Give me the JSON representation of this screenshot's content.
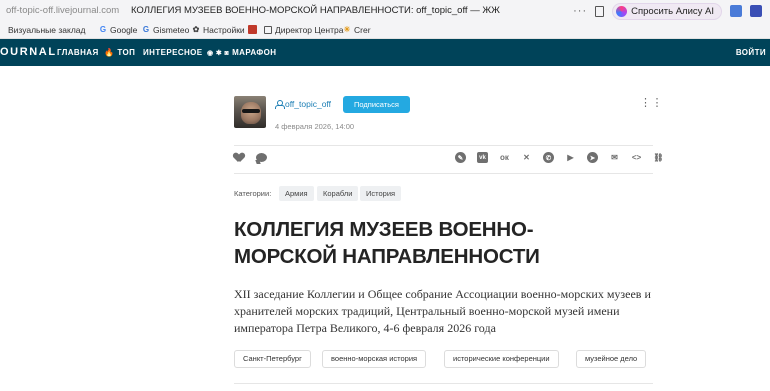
{
  "browser": {
    "url": "off-topic-off.livejournal.com",
    "tab_title": "КОЛЛЕГИЯ МУЗЕЕВ ВОЕННО-МОРСКОЙ НАПРАВЛЕННОСТИ: off_topic_off — ЖЖ",
    "alice_label": "Спросить Алису AI"
  },
  "bookmarks": [
    {
      "label": "Визуальные заклад",
      "icon": "visual-bookmarks-icon"
    },
    {
      "label": "Google",
      "icon": "google-icon"
    },
    {
      "label": "Gismeteo",
      "icon": "gismeteo-icon"
    },
    {
      "label": "Настройки",
      "icon": "gear-icon"
    },
    {
      "label": "",
      "icon": "red-square-icon"
    },
    {
      "label": "Директор Центра",
      "icon": "doc-icon"
    },
    {
      "label": "Crer",
      "icon": "sun-icon"
    }
  ],
  "nav": {
    "logo": "OURNAL",
    "items": [
      "ГЛАВНАЯ",
      "ТОП",
      "ИНТЕРЕСНОЕ",
      "МАРАФОН"
    ],
    "login": "ВОЙТИ"
  },
  "post": {
    "author": "off_topic_off",
    "subscribe": "Подписаться",
    "date": "4 февраля 2026, 14:00",
    "more": "⋮⋮⋮",
    "categories_label": "Категории:",
    "categories": [
      "Армия",
      "Корабли",
      "История"
    ],
    "title": "КОЛЛЕГИЯ МУЗЕЕВ ВОЕННО-МОРСКОЙ НАПРАВЛЕННОСТИ",
    "lead": "XII заседание Коллегии и Общее собрание Ассоциации военно-морских музеев и хранителей морских традиций, Центральный военно-морской музей имени императора Петра Великого, 4-6 февраля 2026 года",
    "tags": [
      "Санкт-Петербург",
      "военно-морская история",
      "исторические конференции",
      "музейное дело"
    ]
  },
  "colors": {
    "nav_bg": "#004359",
    "accent": "#24a9e1",
    "link": "#1d7fb5"
  }
}
